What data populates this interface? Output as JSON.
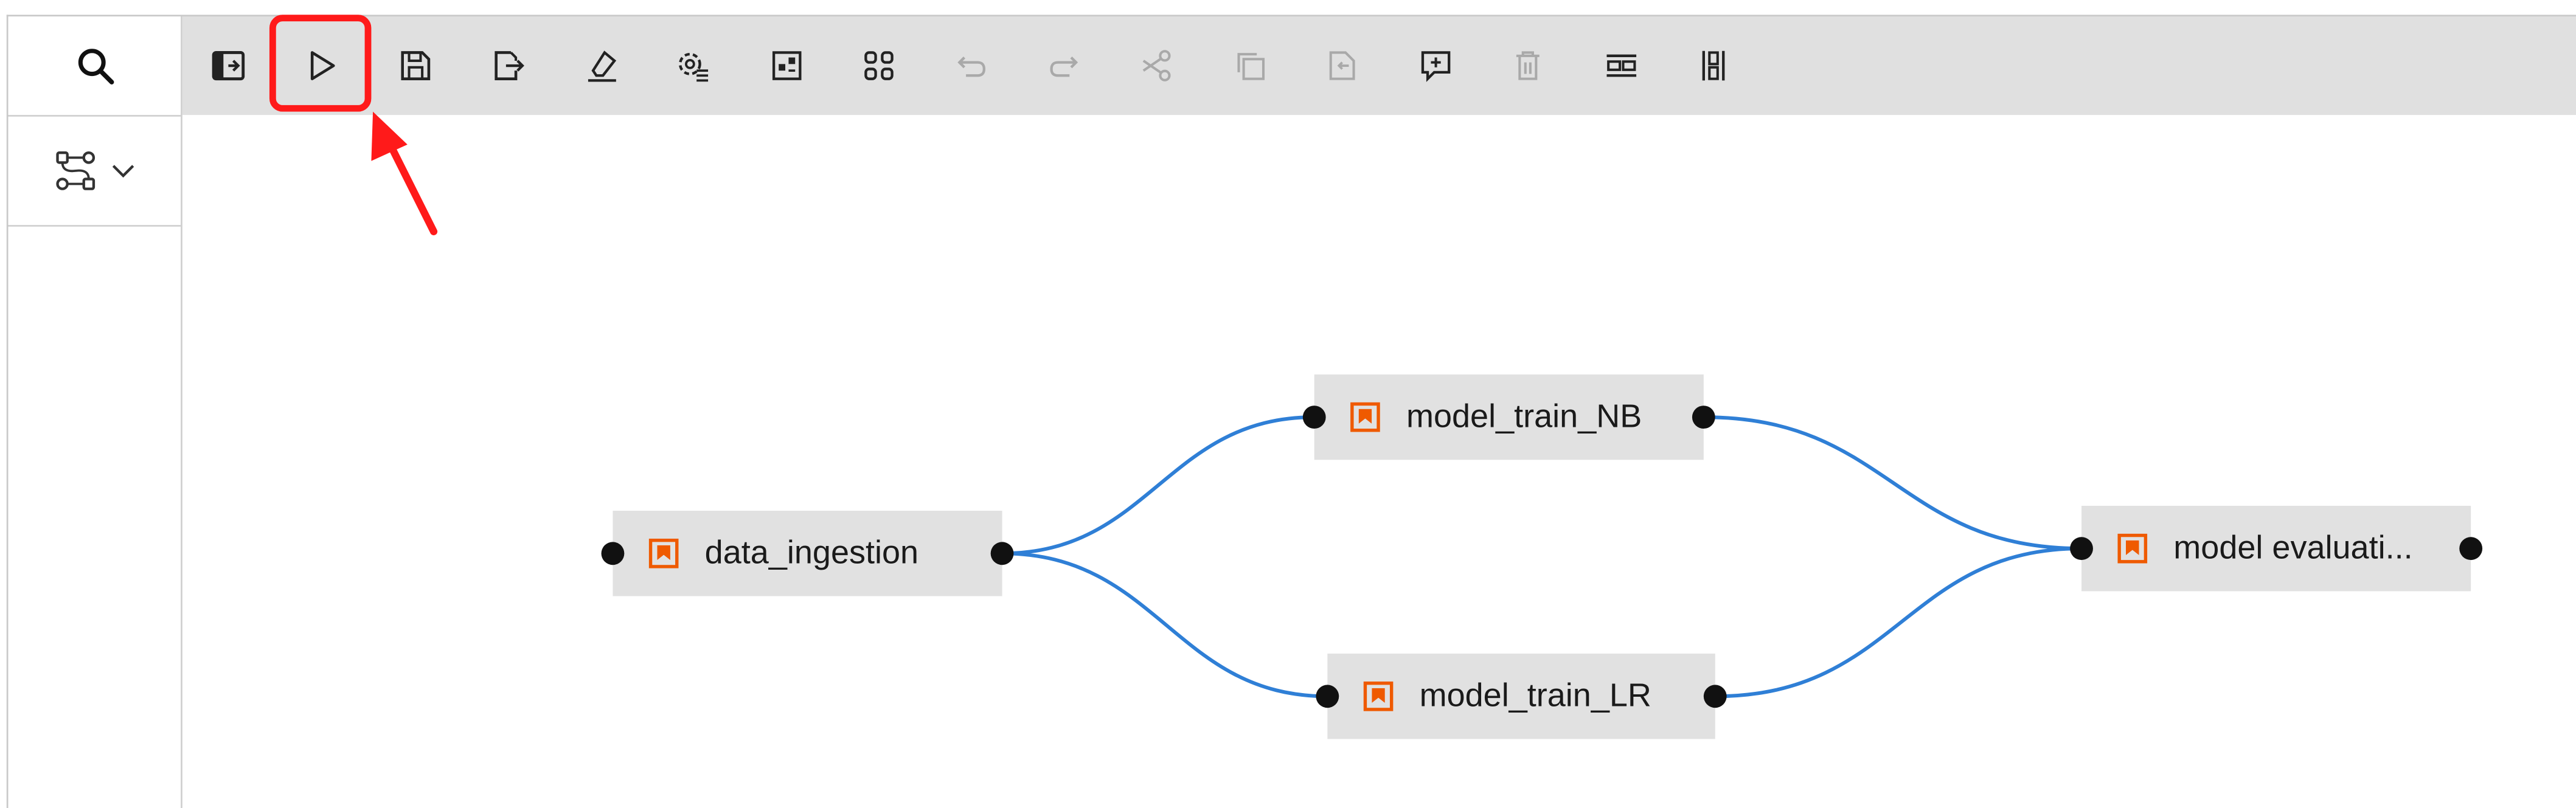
{
  "toolbar": {
    "buttons": [
      {
        "icon": "open-panel-icon",
        "name": "open-panel-button",
        "enabled": true
      },
      {
        "icon": "run-icon",
        "name": "run-pipeline-button",
        "enabled": true,
        "highlighted": true
      },
      {
        "icon": "save-icon",
        "name": "save-pipeline-button",
        "enabled": true
      },
      {
        "icon": "export-icon",
        "name": "export-pipeline-button",
        "enabled": true
      },
      {
        "icon": "clear-icon",
        "name": "clear-pipeline-button",
        "enabled": true
      },
      {
        "icon": "runtime-settings-icon",
        "name": "pipeline-properties-button",
        "enabled": true
      },
      {
        "icon": "add-comment-panel-icon",
        "name": "open-palette-button",
        "enabled": true
      },
      {
        "icon": "arrange-nodes-icon",
        "name": "arrange-nodes-button",
        "enabled": true
      },
      {
        "icon": "undo-icon",
        "name": "undo-button",
        "enabled": false
      },
      {
        "icon": "redo-icon",
        "name": "redo-button",
        "enabled": false
      },
      {
        "icon": "cut-icon",
        "name": "cut-button",
        "enabled": false
      },
      {
        "icon": "copy-icon",
        "name": "copy-button",
        "enabled": false
      },
      {
        "icon": "paste-icon",
        "name": "paste-button",
        "enabled": false
      },
      {
        "icon": "add-comment-icon",
        "name": "add-comment-button",
        "enabled": true
      },
      {
        "icon": "delete-icon",
        "name": "delete-button",
        "enabled": false
      },
      {
        "icon": "horizontal-layout-icon",
        "name": "arrange-horizontal-button",
        "enabled": true
      },
      {
        "icon": "vertical-layout-icon",
        "name": "arrange-vertical-button",
        "enabled": true
      }
    ]
  },
  "sidebar": {
    "search_icon": "search-icon",
    "pipeline_icon": "pipeline-icon",
    "dropdown_icon": "chevron-down-icon"
  },
  "nodes": [
    {
      "id": "data_ingestion",
      "label": "data_ingestion"
    },
    {
      "id": "model_train_NB",
      "label": "model_train_NB"
    },
    {
      "id": "model_train_LR",
      "label": "model_train_LR"
    },
    {
      "id": "model_evaluation",
      "label": "model evaluati..."
    }
  ],
  "links": [
    {
      "from": "data_ingestion",
      "to": "model_train_NB"
    },
    {
      "from": "data_ingestion",
      "to": "model_train_LR"
    },
    {
      "from": "model_train_NB",
      "to": "model_evaluation"
    },
    {
      "from": "model_train_LR",
      "to": "model_evaluation"
    }
  ],
  "colors": {
    "accent_highlight": "#ff1a1a",
    "link": "#2f7fd6",
    "node_icon": "#ef5a00",
    "node_bg": "#e1e1e1",
    "toolbar_bg": "#e0e0e0"
  }
}
